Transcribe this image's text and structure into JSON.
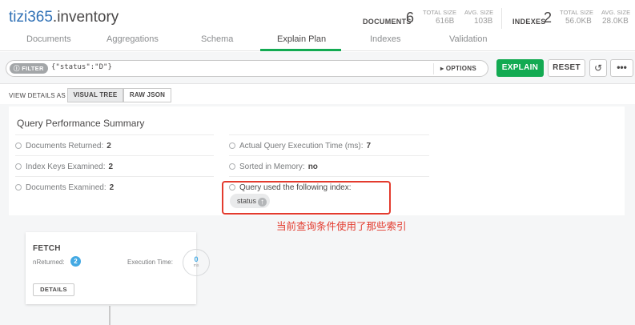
{
  "header": {
    "db_name": "tizi365",
    "collection": ".inventory",
    "documents": {
      "label": "DOCUMENTS",
      "count": "6",
      "total_size_label": "TOTAL SIZE",
      "total_size": "616B",
      "avg_size_label": "AVG. SIZE",
      "avg_size": "103B"
    },
    "indexes": {
      "label": "INDEXES",
      "count": "2",
      "total_size_label": "TOTAL SIZE",
      "total_size": "56.0KB",
      "avg_size_label": "AVG. SIZE",
      "avg_size": "28.0KB"
    }
  },
  "tabs": [
    {
      "label": "Documents"
    },
    {
      "label": "Aggregations"
    },
    {
      "label": "Schema"
    },
    {
      "label": "Explain Plan",
      "active": true
    },
    {
      "label": "Indexes"
    },
    {
      "label": "Validation"
    }
  ],
  "toolbar": {
    "filter_label": "FILTER",
    "filter_value": "{\"status\":\"D\"}",
    "options_label": "OPTIONS",
    "explain_label": "EXPLAIN",
    "reset_label": "RESET",
    "more_label": "•••",
    "accent_color": "#13aa52"
  },
  "view": {
    "label": "VIEW DETAILS AS",
    "visual_tree": "VISUAL TREE",
    "raw_json": "RAW JSON",
    "active": "VISUAL TREE"
  },
  "summary": {
    "title": "Query Performance Summary",
    "left": [
      {
        "label": "Documents Returned:",
        "value": "2"
      },
      {
        "label": "Index Keys Examined:",
        "value": "2"
      },
      {
        "label": "Documents Examined:",
        "value": "2"
      }
    ],
    "right": [
      {
        "label": "Actual Query Execution Time (ms):",
        "value": "7"
      },
      {
        "label": "Sorted in Memory:",
        "value": "no"
      },
      {
        "label": "Query used the following index:",
        "value": ""
      }
    ],
    "index_name": "status"
  },
  "annotation": {
    "text": "当前查询条件使用了那些索引",
    "color": "#e33b2e"
  },
  "stage": {
    "name": "FETCH",
    "nreturned_label": "nReturned:",
    "nreturned": "2",
    "exec_time_label": "Execution Time:",
    "exec_time": "0",
    "exec_time_unit": "ms",
    "details_label": "DETAILS"
  }
}
